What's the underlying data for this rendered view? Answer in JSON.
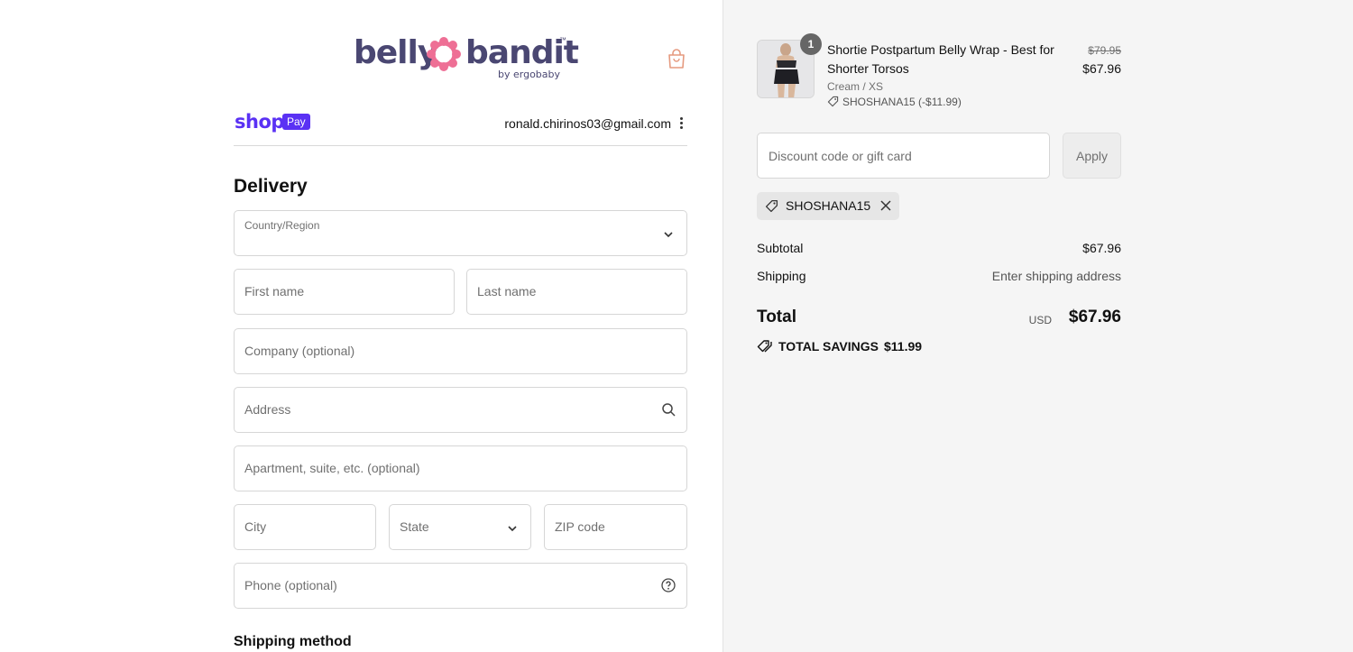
{
  "brand": {
    "name_left": "belly",
    "name_right": "bandit",
    "trademark": "™",
    "sub": "by ergobaby"
  },
  "shop_pay": {
    "shop": "shop",
    "pay": "Pay",
    "email": "ronald.chirinos03@gmail.com"
  },
  "delivery": {
    "heading": "Delivery",
    "country_label": "Country/Region",
    "first_name": "First name",
    "last_name": "Last name",
    "company": "Company (optional)",
    "address": "Address",
    "apartment": "Apartment, suite, etc. (optional)",
    "city": "City",
    "state": "State",
    "zip": "ZIP code",
    "phone": "Phone (optional)"
  },
  "shipping_method_heading": "Shipping method",
  "cart": {
    "item": {
      "quantity": "1",
      "name": "Shortie Postpartum Belly Wrap - Best for Shorter Torsos",
      "variant": "Cream / XS",
      "discount": "SHOSHANA15 (-$11.99)",
      "original_price": "$79.95",
      "price": "$67.96"
    },
    "discount_placeholder": "Discount code or gift card",
    "apply_label": "Apply",
    "applied_code": "SHOSHANA15",
    "subtotal_label": "Subtotal",
    "subtotal_value": "$67.96",
    "shipping_label": "Shipping",
    "shipping_value": "Enter shipping address",
    "total_label": "Total",
    "total_currency": "USD",
    "total_value": "$67.96",
    "savings_label": "TOTAL SAVINGS",
    "savings_value": "$11.99"
  },
  "colors": {
    "brand": "#4a4772",
    "brand_flower": "#ee6f95",
    "shop_pay": "#5a31f4",
    "sidebar_bg": "#f5f5f5"
  },
  "icons": [
    "shopping-bag-icon",
    "kebab-menu-icon",
    "chevron-down-icon",
    "search-icon",
    "help-circle-icon",
    "tag-icon",
    "close-icon",
    "savings-tag-icon"
  ]
}
